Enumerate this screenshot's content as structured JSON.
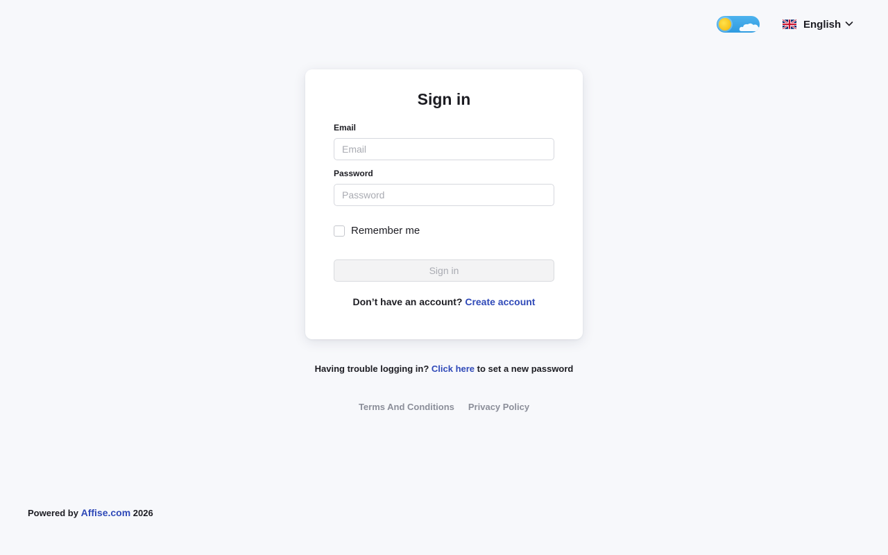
{
  "header": {
    "theme_toggle": {
      "mode": "light",
      "icon": "sun-icon"
    },
    "language": {
      "flag": "uk-flag-icon",
      "label": "English",
      "chevron": "chevron-down-icon"
    }
  },
  "signin_card": {
    "title": "Sign in",
    "email": {
      "label": "Email",
      "placeholder": "Email",
      "value": ""
    },
    "password": {
      "label": "Password",
      "placeholder": "Password",
      "value": ""
    },
    "remember_me": {
      "label": "Remember me",
      "checked": false
    },
    "submit_label": "Sign in",
    "no_account_text": "Don’t have an account?",
    "create_account_link": "Create account"
  },
  "trouble": {
    "prefix": "Having trouble logging in?",
    "link": "Click here",
    "suffix": "to set a new password"
  },
  "legal": {
    "terms": "Terms And Conditions",
    "privacy": "Privacy Policy"
  },
  "footer": {
    "powered_by": "Powered by",
    "brand": "Affise.com",
    "year": "2026"
  },
  "colors": {
    "background": "#f7f8fb",
    "link": "#2f49b8",
    "muted": "#8b8e99"
  }
}
